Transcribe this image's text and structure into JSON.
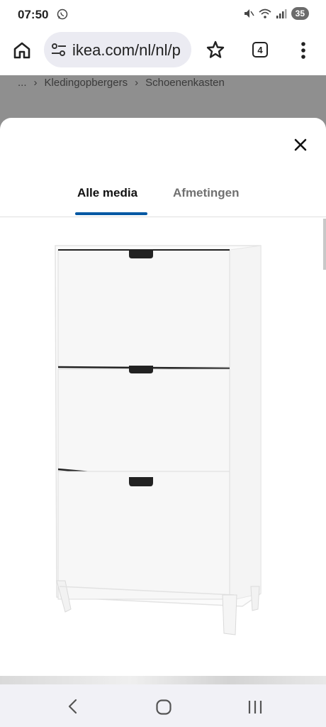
{
  "status_bar": {
    "time": "07:50",
    "battery": "35"
  },
  "browser": {
    "url": "ikea.com/nl/nl/p",
    "tab_count": "4"
  },
  "breadcrumb": {
    "ellipsis": "...",
    "items": [
      "Kledingopbergers",
      "Schoenenkasten"
    ]
  },
  "media_sheet": {
    "tabs": [
      {
        "label": "Alle media",
        "active": true
      },
      {
        "label": "Afmetingen",
        "active": false
      }
    ]
  },
  "colors": {
    "accent": "#0058a3",
    "tab_inactive": "#707070",
    "backdrop": "#8f8f8f"
  }
}
